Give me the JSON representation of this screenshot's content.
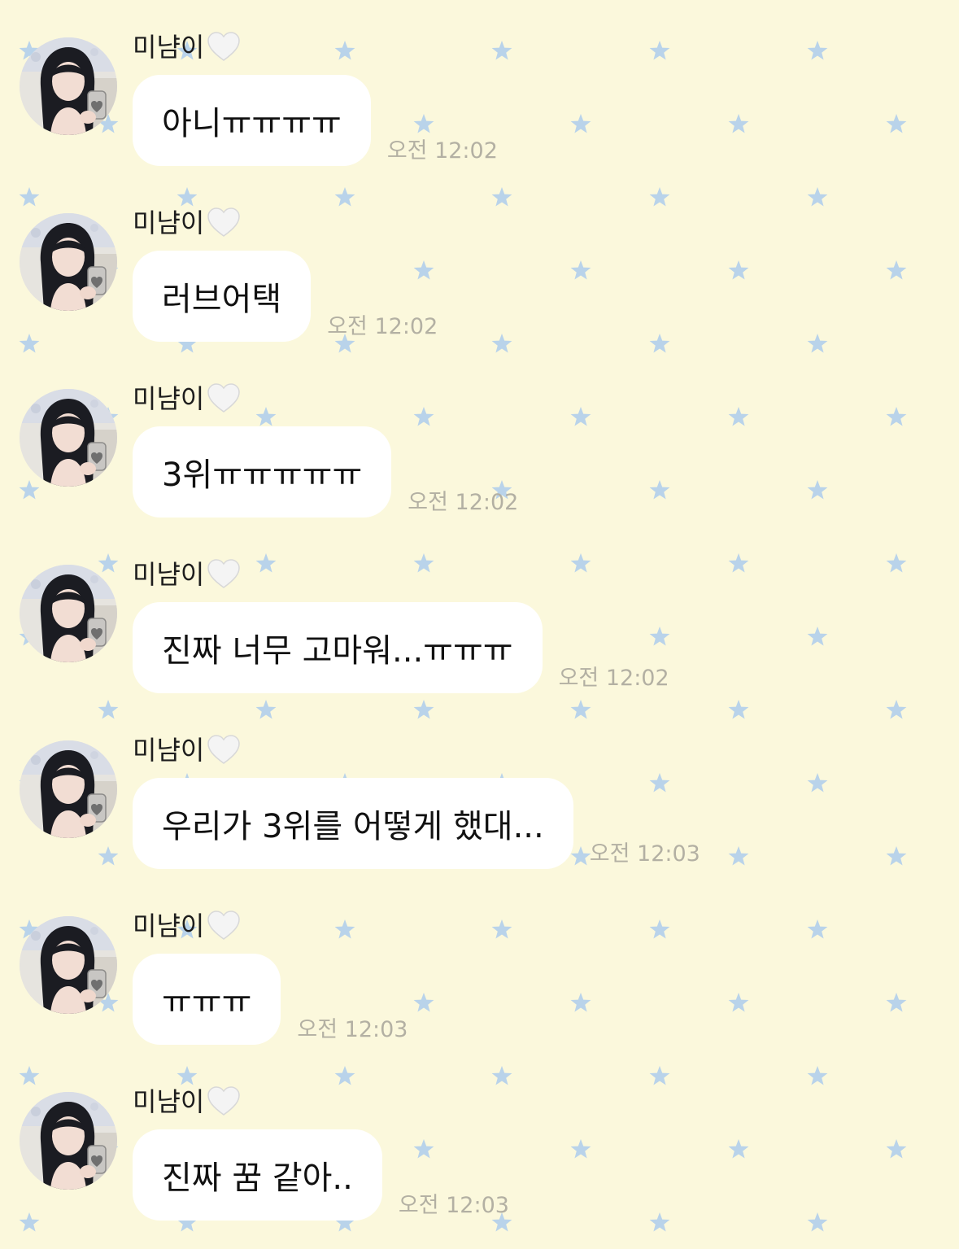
{
  "theme": {
    "background": "#fbf8dc",
    "star_color": "#b9d3ea",
    "bubble_color": "#ffffff",
    "time_color": "#b3b0a3"
  },
  "messages": [
    {
      "sender": "미냠이",
      "sender_icon": "white-heart-icon",
      "text": "아니ㅠㅠㅠㅠ",
      "time": "오전 12:02"
    },
    {
      "sender": "미냠이",
      "sender_icon": "white-heart-icon",
      "text": "러브어택",
      "time": "오전 12:02"
    },
    {
      "sender": "미냠이",
      "sender_icon": "white-heart-icon",
      "text": "3위ㅠㅠㅠㅠㅠ",
      "time": "오전 12:02"
    },
    {
      "sender": "미냠이",
      "sender_icon": "white-heart-icon",
      "text": "진짜 너무 고마워...ㅠㅠㅠ",
      "time": "오전 12:02"
    },
    {
      "sender": "미냠이",
      "sender_icon": "white-heart-icon",
      "text": "우리가 3위를 어떻게 했대...",
      "time": "오전 12:03"
    },
    {
      "sender": "미냠이",
      "sender_icon": "white-heart-icon",
      "text": "ㅠㅠㅠ",
      "time": "오전 12:03"
    },
    {
      "sender": "미냠이",
      "sender_icon": "white-heart-icon",
      "text": "진짜 꿈 같아..",
      "time": "오전 12:03"
    }
  ]
}
